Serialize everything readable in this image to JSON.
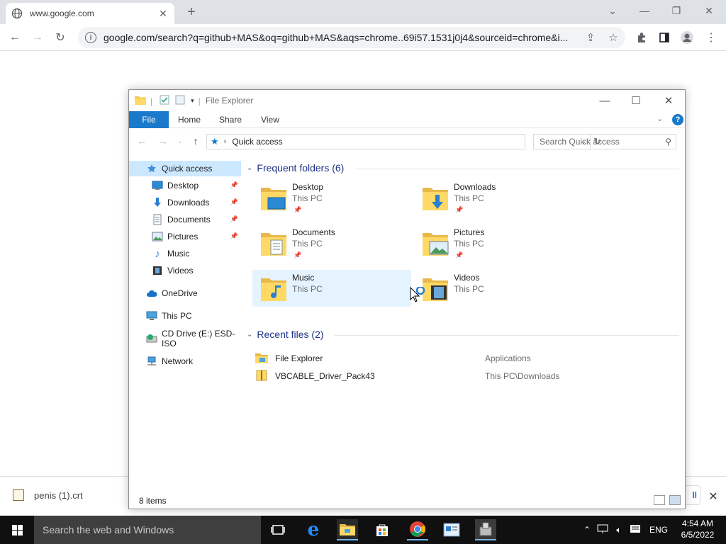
{
  "browser": {
    "tab_title": "www.google.com",
    "url": "google.com/search?q=github+MAS&oq=github+MAS&aqs=chrome..69i57.1531j0j4&sourceid=chrome&i...",
    "accent": "#1a73e8"
  },
  "download_bar": {
    "file_name": "penis (1).crt",
    "show_all_label": "ll"
  },
  "taskbar": {
    "search_placeholder": "Search the web and Windows",
    "language": "ENG",
    "time": "4:54 AM",
    "date": "6/5/2022",
    "pinned_icons": [
      "task-view-icon",
      "edge-icon",
      "file-explorer-icon",
      "store-icon",
      "chrome-icon",
      "app-icon",
      "installer-icon"
    ]
  },
  "explorer": {
    "title": "File Explorer",
    "ribbon_tabs": [
      "File",
      "Home",
      "Share",
      "View"
    ],
    "address": "Quick access",
    "search_placeholder": "Search Quick access",
    "nav": [
      {
        "label": "Quick access",
        "icon": "star-icon"
      },
      {
        "label": "Desktop",
        "icon": "desktop-icon",
        "pinned": true
      },
      {
        "label": "Downloads",
        "icon": "download-icon",
        "pinned": true
      },
      {
        "label": "Documents",
        "icon": "documents-icon",
        "pinned": true
      },
      {
        "label": "Pictures",
        "icon": "pictures-icon",
        "pinned": true
      },
      {
        "label": "Music",
        "icon": "music-icon"
      },
      {
        "label": "Videos",
        "icon": "videos-icon"
      },
      {
        "label": "OneDrive",
        "icon": "cloud-icon"
      },
      {
        "label": "This PC",
        "icon": "computer-icon"
      },
      {
        "label": "CD Drive (E:) ESD-ISO",
        "icon": "cd-drive-icon"
      },
      {
        "label": "Network",
        "icon": "network-icon"
      }
    ],
    "frequent_header": "Frequent folders (6)",
    "frequent": [
      {
        "name": "Desktop",
        "location": "This PC",
        "pinned": true
      },
      {
        "name": "Downloads",
        "location": "This PC",
        "pinned": true
      },
      {
        "name": "Documents",
        "location": "This PC",
        "pinned": true
      },
      {
        "name": "Pictures",
        "location": "This PC",
        "pinned": true
      },
      {
        "name": "Music",
        "location": "This PC",
        "pinned": false
      },
      {
        "name": "Videos",
        "location": "This PC",
        "pinned": false
      }
    ],
    "recent_header": "Recent files (2)",
    "recent": [
      {
        "name": "File Explorer",
        "location": "Applications"
      },
      {
        "name": "VBCABLE_Driver_Pack43",
        "location": "This PC\\Downloads"
      }
    ],
    "status": "8 items"
  }
}
